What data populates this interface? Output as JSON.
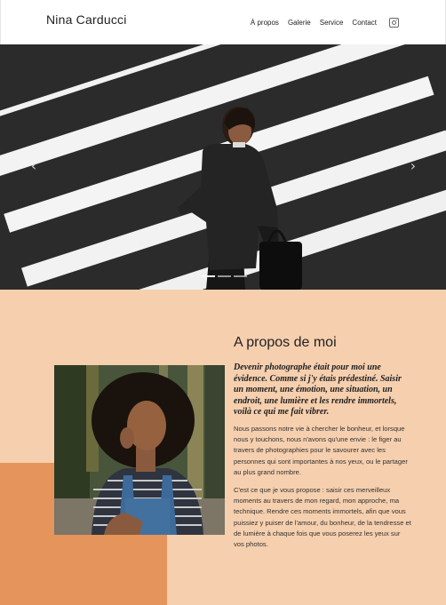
{
  "header": {
    "brand": "Nina Carducci",
    "nav": [
      "À propos",
      "Galerie",
      "Service",
      "Contact"
    ],
    "instagram_icon": "instagram-icon"
  },
  "hero": {
    "prev_icon": "chevron-left-icon",
    "next_icon": "chevron-right-icon",
    "slide_count": 3,
    "active_slide": 1
  },
  "about": {
    "title": "A propos de moi",
    "lead": "Devenir photographe était pour moi une évidence. Comme si j'y étais prédestiné. Saisir un moment, une émotion, une situation, un endroit, une lumière et les rendre immortels, voilà ce qui me fait vibrer.",
    "paragraph1": "Nous passons notre vie à chercher le bonheur, et lorsque nous y touchons, nous n'avons qu'une envie : le figer au travers de photographies pour le savourer avec les personnes qui sont importantes à nos yeux, ou le partager au plus grand nombre.",
    "paragraph2": "C'est ce que je vous propose : saisir ces merveilleux moments au travers de mon regard, mon approche, ma technique. Rendre ces moments immortels, afin que vous puissiez y puiser de l'amour, du bonheur, de la tendresse et de lumière à chaque fois que vous poserez les yeux sur vos photos."
  },
  "colors": {
    "section_bg": "#f5cfae",
    "accent": "#e5955c"
  }
}
